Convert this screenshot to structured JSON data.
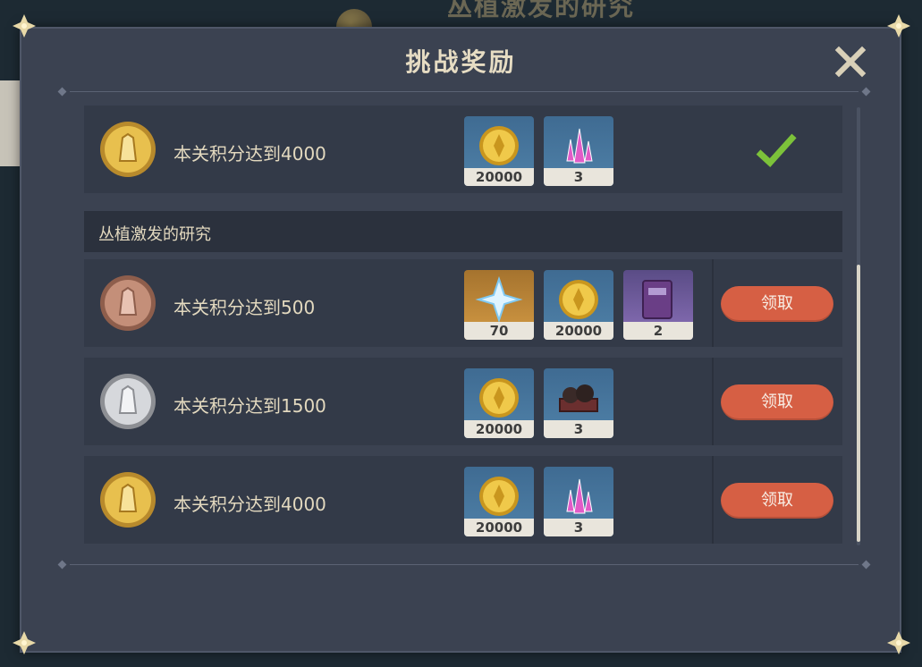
{
  "background": {
    "title": "丛植激发的研究"
  },
  "dialog": {
    "title": "挑战奖励"
  },
  "top_row": {
    "label": "本关积分达到4000",
    "medal": "gold-medal-icon",
    "rewards": [
      {
        "icon": "mora-coin-icon",
        "count": "20000"
      },
      {
        "icon": "pink-crystal-icon",
        "count": "3"
      }
    ],
    "status": "completed-check-icon"
  },
  "section": {
    "title": "丛植激发的研究",
    "rows": [
      {
        "label": "本关积分达到500",
        "medal": "bronze-medal-icon",
        "rewards": [
          {
            "icon": "primogem-icon",
            "count": "70"
          },
          {
            "icon": "mora-coin-icon",
            "count": "20000"
          },
          {
            "icon": "purple-book-icon",
            "count": "2"
          }
        ],
        "button": "领取"
      },
      {
        "label": "本关积分达到1500",
        "medal": "silver-medal-icon",
        "rewards": [
          {
            "icon": "mora-coin-icon",
            "count": "20000"
          },
          {
            "icon": "ore-cart-icon",
            "count": "3"
          }
        ],
        "button": "领取"
      },
      {
        "label": "本关积分达到4000",
        "medal": "gold-medal-icon",
        "rewards": [
          {
            "icon": "mora-coin-icon",
            "count": "20000"
          },
          {
            "icon": "pink-crystal-icon",
            "count": "3"
          }
        ],
        "button": "领取"
      }
    ]
  },
  "colors": {
    "panel": "#3b4251",
    "claim_button": "#d65f44",
    "check": "#7cc23a"
  }
}
